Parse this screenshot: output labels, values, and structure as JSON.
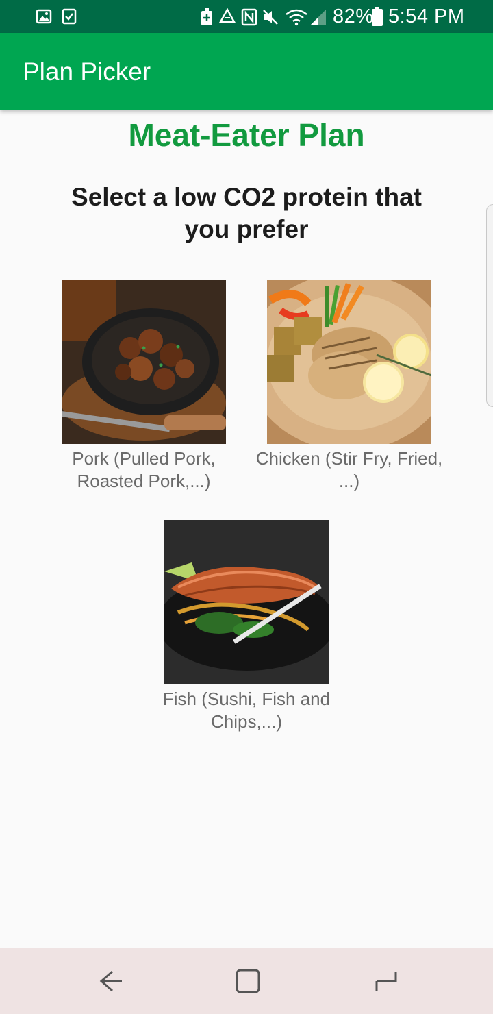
{
  "status_bar": {
    "battery_percent": "82%",
    "time": "5:54 PM",
    "left_icons": [
      "image-icon",
      "checklist-icon"
    ],
    "right_icons": [
      "battery-saver-icon",
      "recycle-icon",
      "nfc-icon",
      "mute-icon",
      "wifi-icon",
      "signal-icon",
      "battery-icon"
    ]
  },
  "app_bar": {
    "title": "Plan Picker",
    "color": "#00a651"
  },
  "plan": {
    "title": "Meat-Eater Plan",
    "prompt": "Select a low CO2 protein that you prefer",
    "options": [
      {
        "label": "Pork (Pulled Pork, Roasted Pork,...)",
        "image": "pork-dish"
      },
      {
        "label": "Chicken (Stir Fry, Fried, ...)",
        "image": "chicken-dish"
      },
      {
        "label": "Fish (Sushi, Fish and Chips,...)",
        "image": "fish-dish"
      }
    ]
  },
  "nav_bar": {
    "buttons": [
      "back-icon",
      "home-icon",
      "recents-icon"
    ]
  },
  "colors": {
    "status_bar": "#006b46",
    "accent": "#129a3f",
    "background": "#fafafa"
  }
}
